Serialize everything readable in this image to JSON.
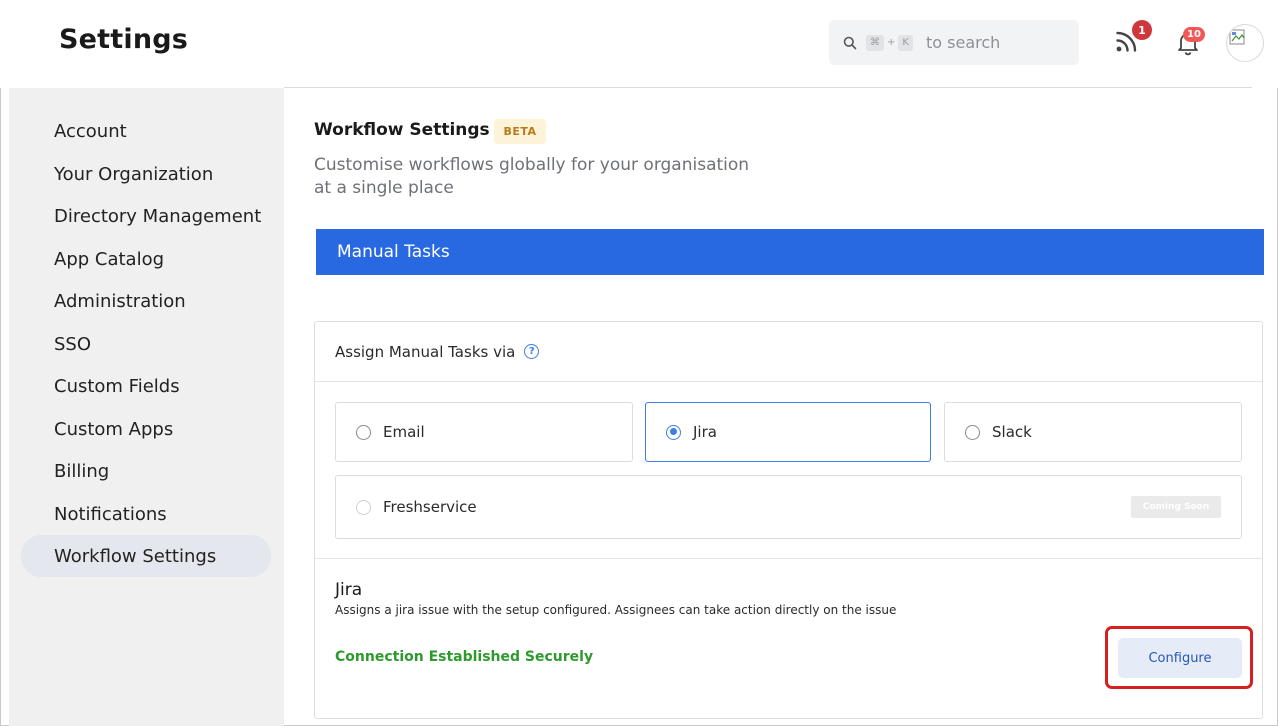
{
  "header": {
    "title": "Settings",
    "search": {
      "shortcut_key1": "⌘",
      "shortcut_plus": "+",
      "shortcut_key2": "K",
      "placeholder": "to search"
    },
    "feed_badge": "1",
    "notification_badge": "10",
    "colors": {
      "feed_badge": "#d0373b",
      "notification_badge": "#f25757"
    }
  },
  "sidebar": {
    "items": [
      {
        "label": "Account"
      },
      {
        "label": "Your Organization"
      },
      {
        "label": "Directory Management"
      },
      {
        "label": "App Catalog"
      },
      {
        "label": "Administration"
      },
      {
        "label": "SSO"
      },
      {
        "label": "Custom Fields"
      },
      {
        "label": "Custom Apps"
      },
      {
        "label": "Billing"
      },
      {
        "label": "Notifications"
      },
      {
        "label": "Workflow Settings",
        "active": true
      }
    ]
  },
  "main": {
    "title": "Workflow Settings",
    "beta_badge": "BETA",
    "subtitle_line1": "Customise workflows globally for your organisation",
    "subtitle_line2": "at a single place",
    "section_title": "Manual Tasks",
    "assign_label": "Assign Manual Tasks via",
    "options": [
      {
        "label": "Email",
        "selected": false
      },
      {
        "label": "Jira",
        "selected": true
      },
      {
        "label": "Slack",
        "selected": false
      },
      {
        "label": "Freshservice",
        "selected": false,
        "disabled": true,
        "tag": "Coming Soon"
      }
    ],
    "jira": {
      "title": "Jira",
      "description": "Assigns a jira issue with the setup configured. Assignees can take action directly on the issue",
      "status": "Connection Established Securely",
      "configure_label": "Configure"
    },
    "colors": {
      "accent": "#2868e0",
      "success": "#2e9a2e",
      "highlight": "#d61f1f"
    }
  }
}
